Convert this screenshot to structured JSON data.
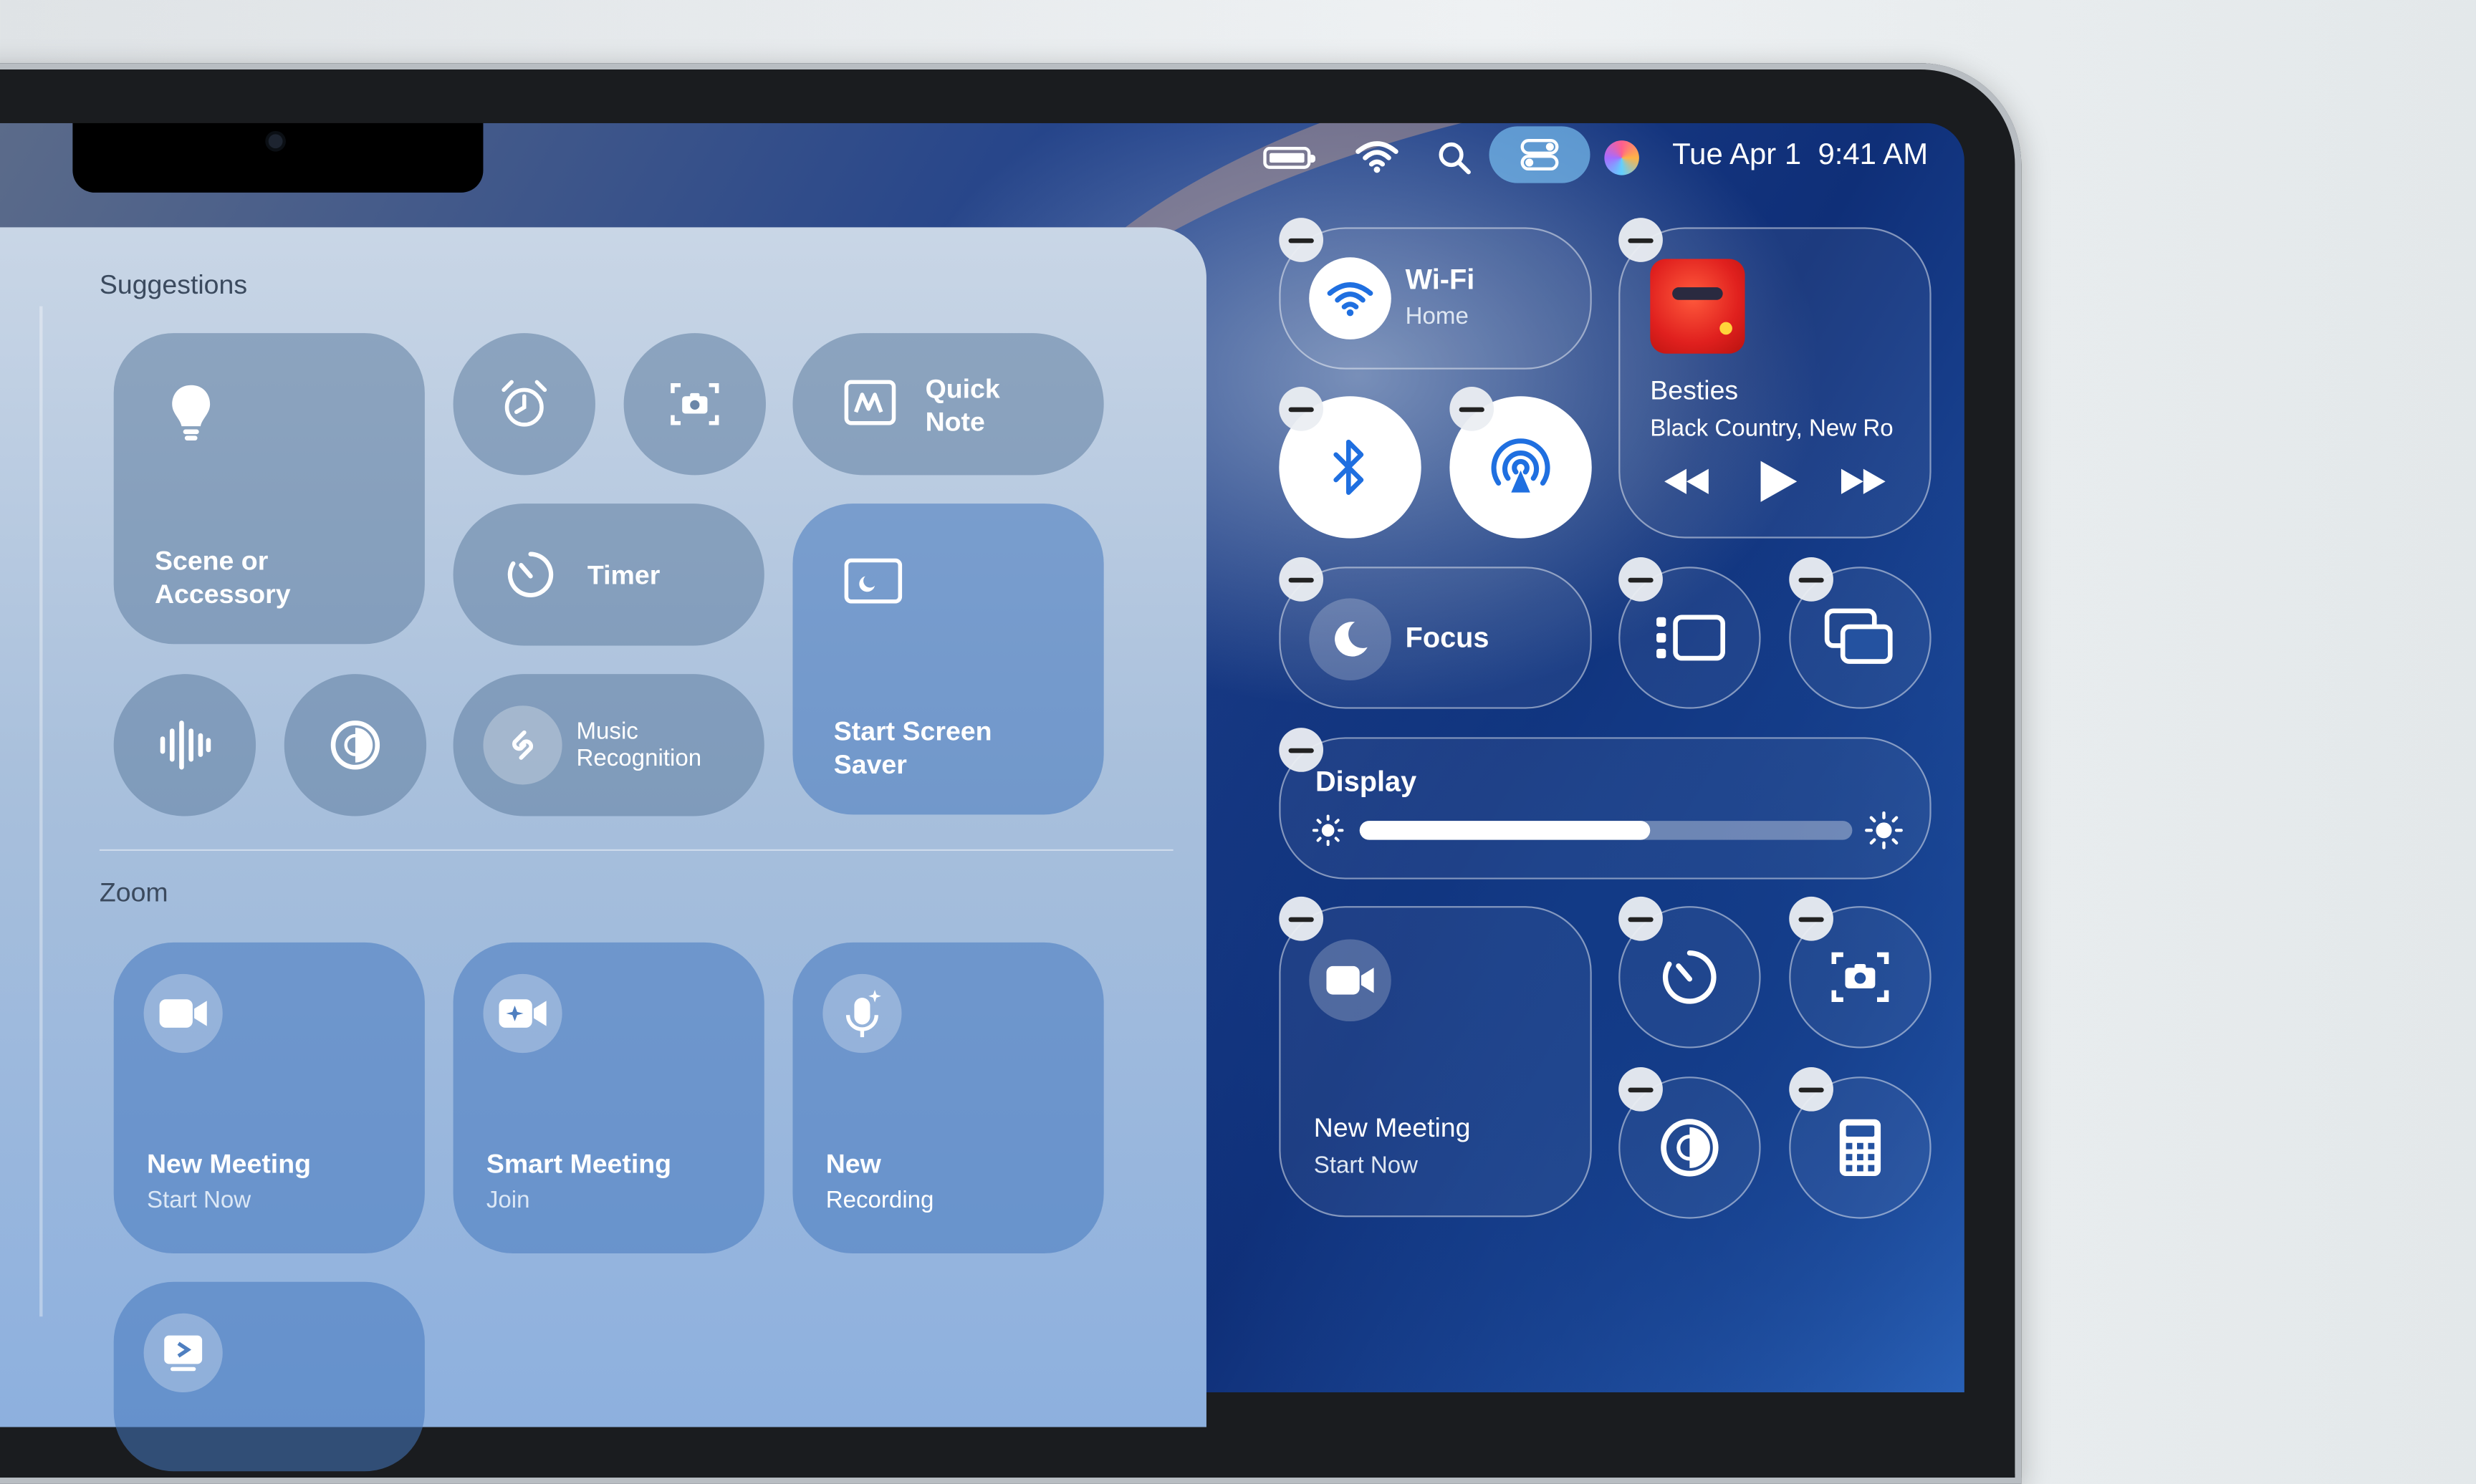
{
  "menubar": {
    "date": "Tue Apr 1",
    "time": "9:41 AM"
  },
  "gallery": {
    "suggestions_heading": "Suggestions",
    "zoom_heading": "Zoom",
    "scene": "Scene or Accessory",
    "quick_note_line1": "Quick",
    "quick_note_line2": "Note",
    "timer": "Timer",
    "start_screen_saver": "Start Screen Saver",
    "music_recognition_line1": "Music",
    "music_recognition_line2": "Recognition",
    "new_meeting": "New Meeting",
    "new_meeting_sub": "Start Now",
    "smart_meeting": "Smart Meeting",
    "smart_meeting_sub": "Join",
    "new_recording": "New",
    "new_recording_sub": "Recording"
  },
  "control_center": {
    "wifi_title": "Wi-Fi",
    "wifi_network": "Home",
    "now_playing_title": "Besties",
    "now_playing_artist": "Black Country, New Ro",
    "focus": "Focus",
    "display": "Display",
    "display_brightness": 0.59,
    "meeting_title": "New Meeting",
    "meeting_sub": "Start Now"
  },
  "colors": {
    "accent_blue": "#1f6fe0",
    "pill_blue": "#78bef0"
  }
}
